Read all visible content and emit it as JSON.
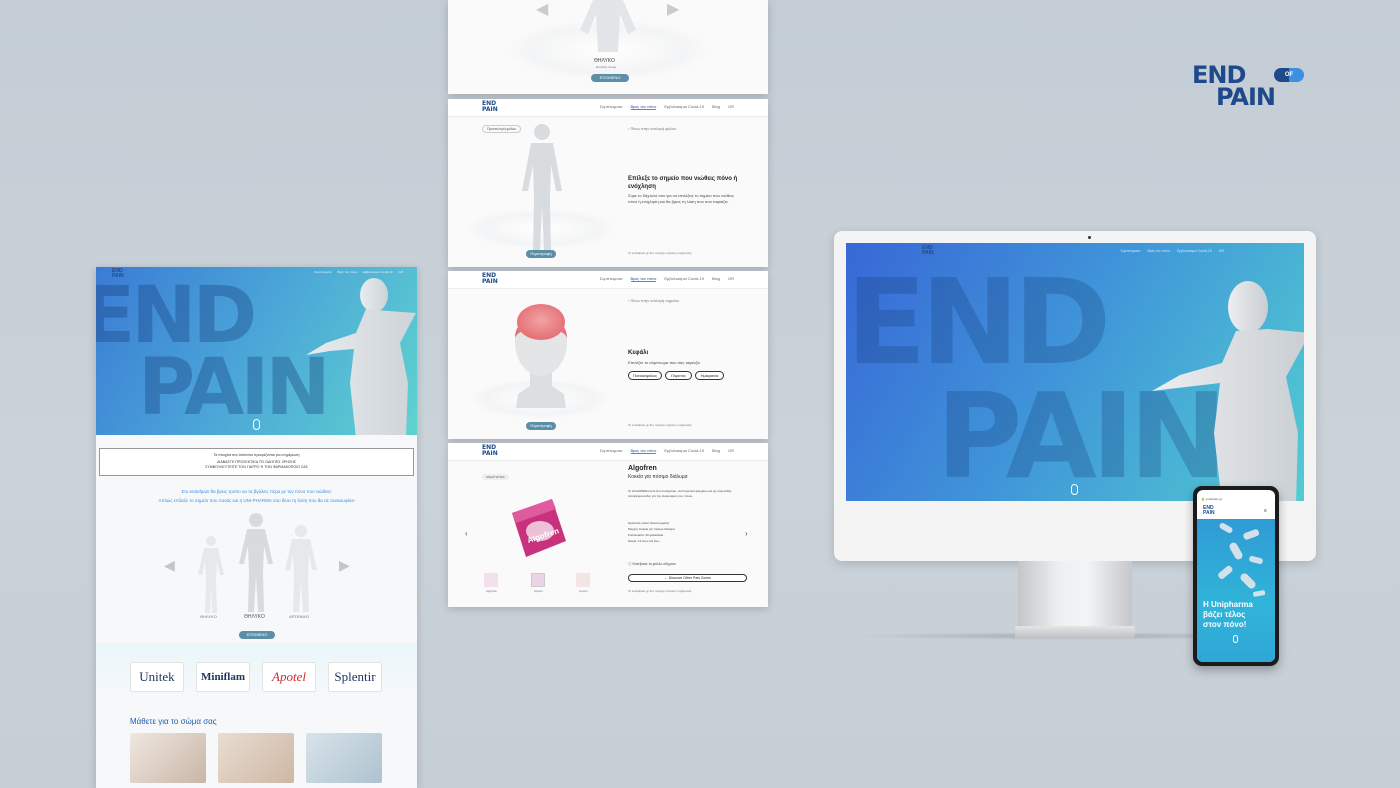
{
  "brand": {
    "line1": "END",
    "line2": "PAIN",
    "pill": "OF"
  },
  "nav": {
    "items": [
      "Συμπτώματα",
      "Βρες τον πόνο",
      "Εμβολιασμοί Covid-19",
      "Blog",
      "GR"
    ]
  },
  "left_page": {
    "nav_items": [
      "Συμπτώματα",
      "Βρες τον πόνο",
      "Εμβολιασμοί Covid-19",
      "GR"
    ],
    "hero_word1": "END",
    "hero_word2": "PAIN",
    "notice_line1": "Τα στοιχεία στο Ιστότοπο προορίζονται για ενημέρωση",
    "notice_line2": "ΔΙΑΒΑΣΤΕ ΠΡΟΣΕΚΤΙΚΑ ΤΙΣ ΟΔΗΓΙΕΣ ΧΡΗΣΗΣ",
    "notice_line3": "ΣΥΜΒΟΥΛΕΥΤΕΙΤΕ ΤΟΝ ΓΙΑΤΡΟ Ή ΤΟΝ ΦΑΡΜΑΚΟΠΟΙΟ ΣΑΣ",
    "intro_line1": "Στο endofpain θα βρεις τρόπο να τα βγάλεις πέρα με τον πόνο που νιώθεις!",
    "intro_line2": "Απλώς επίλεξε το σημείο που πονάς και η UNI-PHARMA σου δίνει τη λύση που θα σε ανακουφίσει",
    "gender_left": "ΘΗΛΥΚΟ",
    "gender_mid": "ΘΗΛΥΚΟ",
    "gender_right": "ΑΡΣΕΝΙΚΟ",
    "next_button": "ΕΠΟΜΕΝΟ",
    "brands": [
      "Unitek",
      "Miniflam",
      "Apotel",
      "Splentir"
    ],
    "section_title": "Μάθετε για το σώμα σας"
  },
  "mid_panel_1": {
    "gender": "ΘΗΛΥΚΟ",
    "sub": "Επιλέξτε άτομο",
    "next_button": "ΕΠΟΜΕΝΟ"
  },
  "mid_panel_2": {
    "tag": "Προεπιλογή φύλου",
    "back": "Πίσω στην επιλογή φύλου",
    "title": "Επίλεξε το σημείο που νιώθεις πόνο ή ενόχληση",
    "text": "Σύρε το δάχτυλό σου για να επιλέξεις το σημείο που νιώθεις πόνο ή ενόχληση και θα βρεις τη λύση που σου ταιριάζει.",
    "button": "Περιστροφή",
    "footer": "Το endofpain.gr δεν παρέχει ιατρικές συμβουλές"
  },
  "mid_panel_3": {
    "back": "Πίσω στην επιλογή σημείου",
    "title": "Κεφάλι",
    "text": "Επιλέξτε το σύμπτωμα που σας ταιριάζει",
    "options": [
      "Πονοκέφαλος",
      "Πυρετός",
      "Ημικρανία"
    ],
    "button": "Περιστροφή",
    "footer": "Το endofpain.gr δεν παρέχει ιατρικές συμβουλές"
  },
  "mid_panel_4": {
    "badge": "ΑΝΑΛΓΗΤΙΚΑ",
    "title": "Algofren",
    "subtitle": "Κοκκία για πόσιμο διάλυμα",
    "desc": "Το ALGOFREN είναι ένα αναλγητικό, αντιπυρετικό φάρμακο και μη στεροειδές αντιφλεγμονώδες για την ανακούφιση του πόνου.",
    "spec1": "Δραστική ουσία: Ιβουπροφαίνη",
    "spec2": "Μορφή: Κοκκία για πόσιμο διάλυμα",
    "spec3": "Συσκευασία: 20 φακελάκια",
    "spec4": "Ηλικία: 12 ετών και άνω",
    "link": "Κατέβασε το φύλλο οδηγιών",
    "discover_button": "Discover Other Pain Zones",
    "thumbs": [
      "Algofren",
      "Apotel",
      "Apotel"
    ],
    "footer": "Το endofpain.gr δεν παρέχει ιατρικές συμβουλές"
  },
  "monitor": {
    "hero_word1": "END",
    "hero_word2": "PAIN"
  },
  "phone": {
    "url": "endofpain.gr",
    "headline_line1": "Η Unipharma",
    "headline_line2": "βάζει τέλος",
    "headline_line3": "στον πόνο!"
  },
  "colors": {
    "brand": "#1e4a8c",
    "accent": "#3d8fe0",
    "teal": "#5fd3cf",
    "button": "#5b8fa8"
  }
}
